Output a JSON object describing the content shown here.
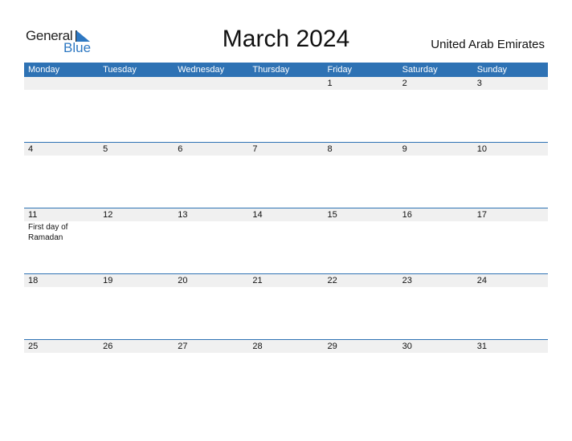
{
  "logo": {
    "word1": "General",
    "word2": "Blue"
  },
  "title": "March 2024",
  "country": "United Arab Emirates",
  "days": [
    "Monday",
    "Tuesday",
    "Wednesday",
    "Thursday",
    "Friday",
    "Saturday",
    "Sunday"
  ],
  "weeks": [
    [
      "",
      "",
      "",
      "",
      "1",
      "2",
      "3"
    ],
    [
      "4",
      "5",
      "6",
      "7",
      "8",
      "9",
      "10"
    ],
    [
      "11",
      "12",
      "13",
      "14",
      "15",
      "16",
      "17"
    ],
    [
      "18",
      "19",
      "20",
      "21",
      "22",
      "23",
      "24"
    ],
    [
      "25",
      "26",
      "27",
      "28",
      "29",
      "30",
      "31"
    ]
  ],
  "events": {
    "11": "First day of Ramadan"
  },
  "colors": {
    "accent": "#2e72b4",
    "strip": "#f0f0f0"
  }
}
